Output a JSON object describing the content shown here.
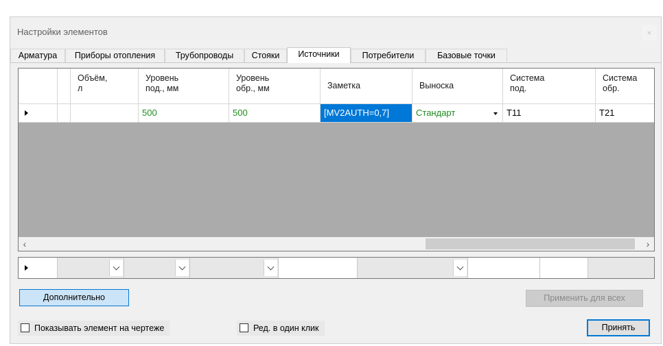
{
  "window": {
    "title": "Настройки элементов",
    "close_glyph": "×"
  },
  "tabs": [
    "Арматура",
    "Приборы отопления",
    "Трубопроводы",
    "Стояки",
    "Источники",
    "Потребители",
    "Базовые точки"
  ],
  "active_tab": "Источники",
  "grid": {
    "columns": [
      "",
      "",
      "Объём,\nл",
      "Уровень\nпод., мм",
      "Уровень\nобр., мм",
      "Заметка",
      "Выноска",
      "Система\nпод.",
      "Система\nобр."
    ],
    "row": {
      "col_volume": "",
      "level_supply": "500",
      "level_return": "500",
      "note": "[MV2AUTH=0,7]",
      "callout": "Стандарт",
      "system_supply": "T11",
      "system_return": "T21"
    },
    "scroll_left": "‹",
    "scroll_right": "›"
  },
  "buttons": {
    "additional": "Дополнительно",
    "apply_all": "Применить для всех",
    "accept": "Принять"
  },
  "checkboxes": {
    "show_element": "Показывать элемент на чертеже",
    "edit_one_click": "Ред. в один клик"
  },
  "colors": {
    "accent": "#0078d7",
    "green_text": "#1e8c1e",
    "grid_bg": "#ababab"
  }
}
